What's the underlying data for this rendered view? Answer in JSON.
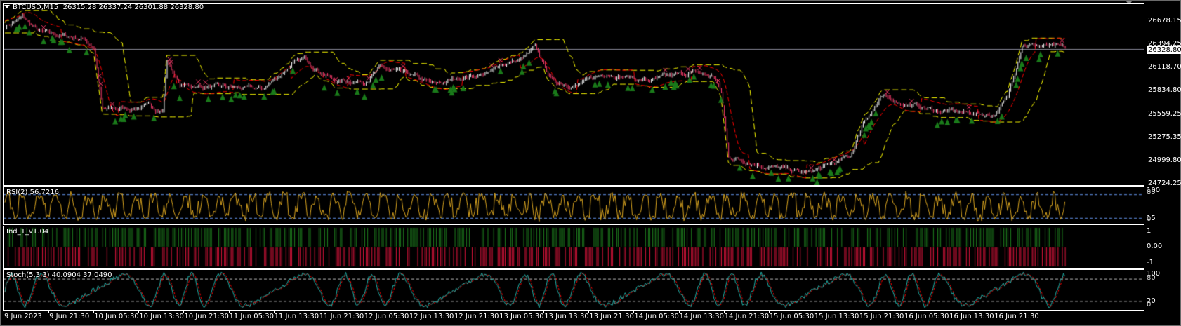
{
  "header": {
    "symbol": "BTCUSD,M15",
    "open": "26315.28",
    "high": "26337.24",
    "low": "26301.88",
    "close": "26328.80"
  },
  "price_axis": {
    "labels": [
      "26678.15",
      "26394.25",
      "26118.70",
      "25834.80",
      "25559.25",
      "25275.35",
      "24999.80",
      "24724.25"
    ],
    "current_price": "26328.80"
  },
  "rsi": {
    "title": "RSI(2) 56.7216",
    "levels": [
      "100",
      "85",
      "15",
      "0"
    ]
  },
  "ind": {
    "title": "Ind_1_v1.04",
    "levels": [
      "1",
      "0.00",
      "-1"
    ]
  },
  "stoch": {
    "title": "Stoch(5,3,3) 40.0904 37.0490",
    "levels": [
      "100",
      "80",
      "20",
      "0"
    ]
  },
  "time_axis": [
    "9 Jun 2023",
    "9 Jun 21:30",
    "10 Jun 05:30",
    "10 Jun 13:30",
    "10 Jun 21:30",
    "11 Jun 05:30",
    "11 Jun 13:30",
    "11 Jun 21:30",
    "12 Jun 05:30",
    "12 Jun 13:30",
    "12 Jun 21:30",
    "13 Jun 05:30",
    "13 Jun 13:30",
    "13 Jun 21:30",
    "14 Jun 05:30",
    "14 Jun 13:30",
    "14 Jun 21:30",
    "15 Jun 05:30",
    "15 Jun 13:30",
    "15 Jun 21:30",
    "16 Jun 05:30",
    "16 Jun 13:30",
    "16 Jun 21:30"
  ],
  "colors": {
    "bull": "#ffffff",
    "bear": "#ff3c6e",
    "band_red": "#ff0000",
    "band_yellow": "#ffff00",
    "arrow": "#1a7a1a",
    "rsi": "#daa520",
    "ind_up": "#1e7d1e",
    "ind_down": "#dc143c",
    "stoch_main": "#20b2aa",
    "stoch_signal": "#ff0000",
    "level": "#6495ed"
  },
  "chart_data": {
    "type": "line",
    "title": "BTCUSD,M15",
    "ylim": [
      24724.25,
      26800
    ],
    "price_path": [
      [
        0,
        26600
      ],
      [
        12,
        26700
      ],
      [
        25,
        26520
      ],
      [
        55,
        26450
      ],
      [
        62,
        26350
      ],
      [
        68,
        25600
      ],
      [
        100,
        25650
      ],
      [
        110,
        25600
      ],
      [
        113,
        26200
      ],
      [
        122,
        25900
      ],
      [
        180,
        25850
      ],
      [
        200,
        26150
      ],
      [
        210,
        26200
      ],
      [
        230,
        25950
      ],
      [
        250,
        25950
      ],
      [
        262,
        26100
      ],
      [
        285,
        26000
      ],
      [
        300,
        25900
      ],
      [
        320,
        26000
      ],
      [
        340,
        26050
      ],
      [
        360,
        26200
      ],
      [
        345,
        26150
      ],
      [
        370,
        26330
      ],
      [
        382,
        25950
      ],
      [
        400,
        25900
      ],
      [
        420,
        26050
      ],
      [
        450,
        25950
      ],
      [
        480,
        26050
      ],
      [
        495,
        26000
      ],
      [
        500,
        25800
      ],
      [
        505,
        25050
      ],
      [
        530,
        24950
      ],
      [
        560,
        24850
      ],
      [
        575,
        24950
      ],
      [
        590,
        25050
      ],
      [
        600,
        25500
      ],
      [
        612,
        25750
      ],
      [
        650,
        25600
      ],
      [
        690,
        25550
      ],
      [
        700,
        25750
      ],
      [
        710,
        26400
      ],
      [
        730,
        26350
      ],
      [
        740,
        26330
      ]
    ]
  }
}
